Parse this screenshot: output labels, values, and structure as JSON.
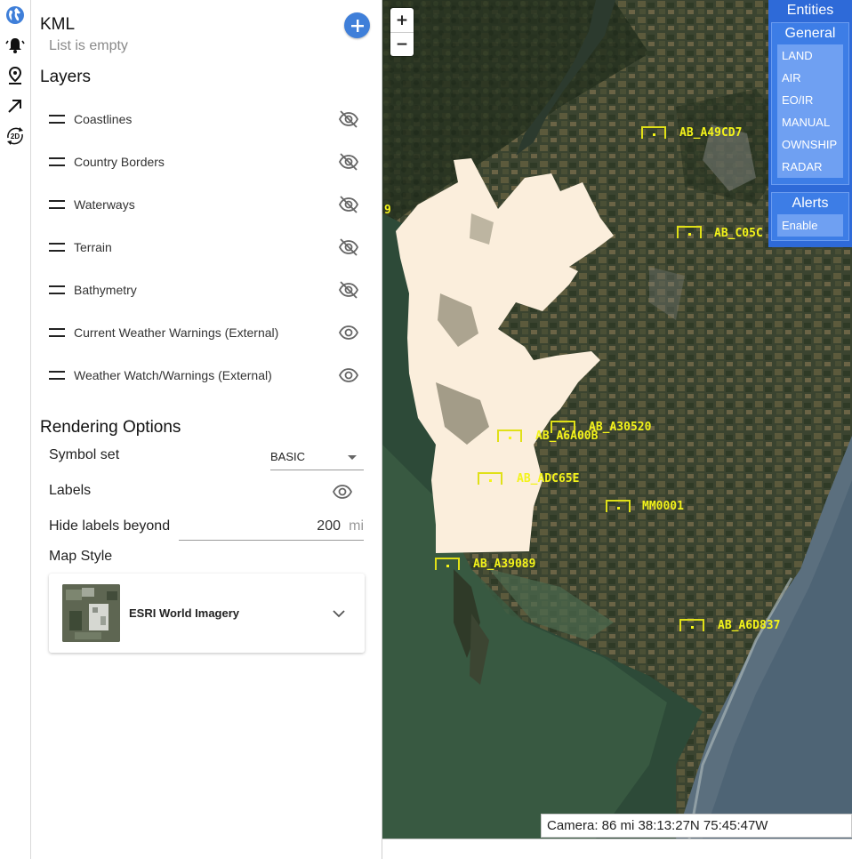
{
  "rail": {
    "icons": [
      "globe-icon",
      "alerts-bell-icon",
      "map-pin-icon",
      "arrow-up-right-icon",
      "2d-toggle-icon"
    ],
    "mode_label": "2D"
  },
  "kml": {
    "title": "KML",
    "empty_text": "List is empty"
  },
  "layers": {
    "title": "Layers",
    "items": [
      {
        "label": "Coastlines",
        "visible": false
      },
      {
        "label": "Country Borders",
        "visible": false
      },
      {
        "label": "Waterways",
        "visible": false
      },
      {
        "label": "Terrain",
        "visible": false
      },
      {
        "label": "Bathymetry",
        "visible": false
      },
      {
        "label": "Current Weather Warnings (External)",
        "visible": true
      },
      {
        "label": "Weather Watch/Warnings (External)",
        "visible": true
      }
    ]
  },
  "rendering": {
    "title": "Rendering Options",
    "symbol_set_label": "Symbol set",
    "symbol_set_value": "BASIC",
    "labels_label": "Labels",
    "labels_visible": true,
    "hide_labels_label": "Hide labels beyond",
    "hide_labels_value": "200",
    "hide_labels_unit": "mi",
    "map_style_label": "Map Style",
    "map_style_value": "ESRI World Imagery"
  },
  "map": {
    "zoom_in": "+",
    "zoom_out": "−",
    "edge_label": "9",
    "tracks": [
      {
        "label": "AB_A49CD7"
      },
      {
        "label": "AB_C05C"
      },
      {
        "label": "AB_A30520"
      },
      {
        "label": "AB_A6A00B"
      },
      {
        "label": "AB_ADC65E"
      },
      {
        "label": "MM0001"
      },
      {
        "label": "AB_A39089"
      },
      {
        "label": "AB_A6D837"
      }
    ],
    "camera_text": "Camera: 86 mi 38:13:27N 75:45:47W"
  },
  "entities": {
    "title": "Entities",
    "general_title": "General",
    "general_items": [
      "LAND",
      "AIR",
      "EO/IR",
      "MANUAL",
      "OWNSHIP",
      "RADAR"
    ],
    "alerts_title": "Alerts",
    "alerts_items": [
      "Enable"
    ]
  },
  "colors": {
    "accent_blue": "#3f7fd9",
    "entity_panel": "#2e6ad8",
    "track_yellow": "#f3f31a",
    "overlay_cream": "#fbeedc"
  }
}
